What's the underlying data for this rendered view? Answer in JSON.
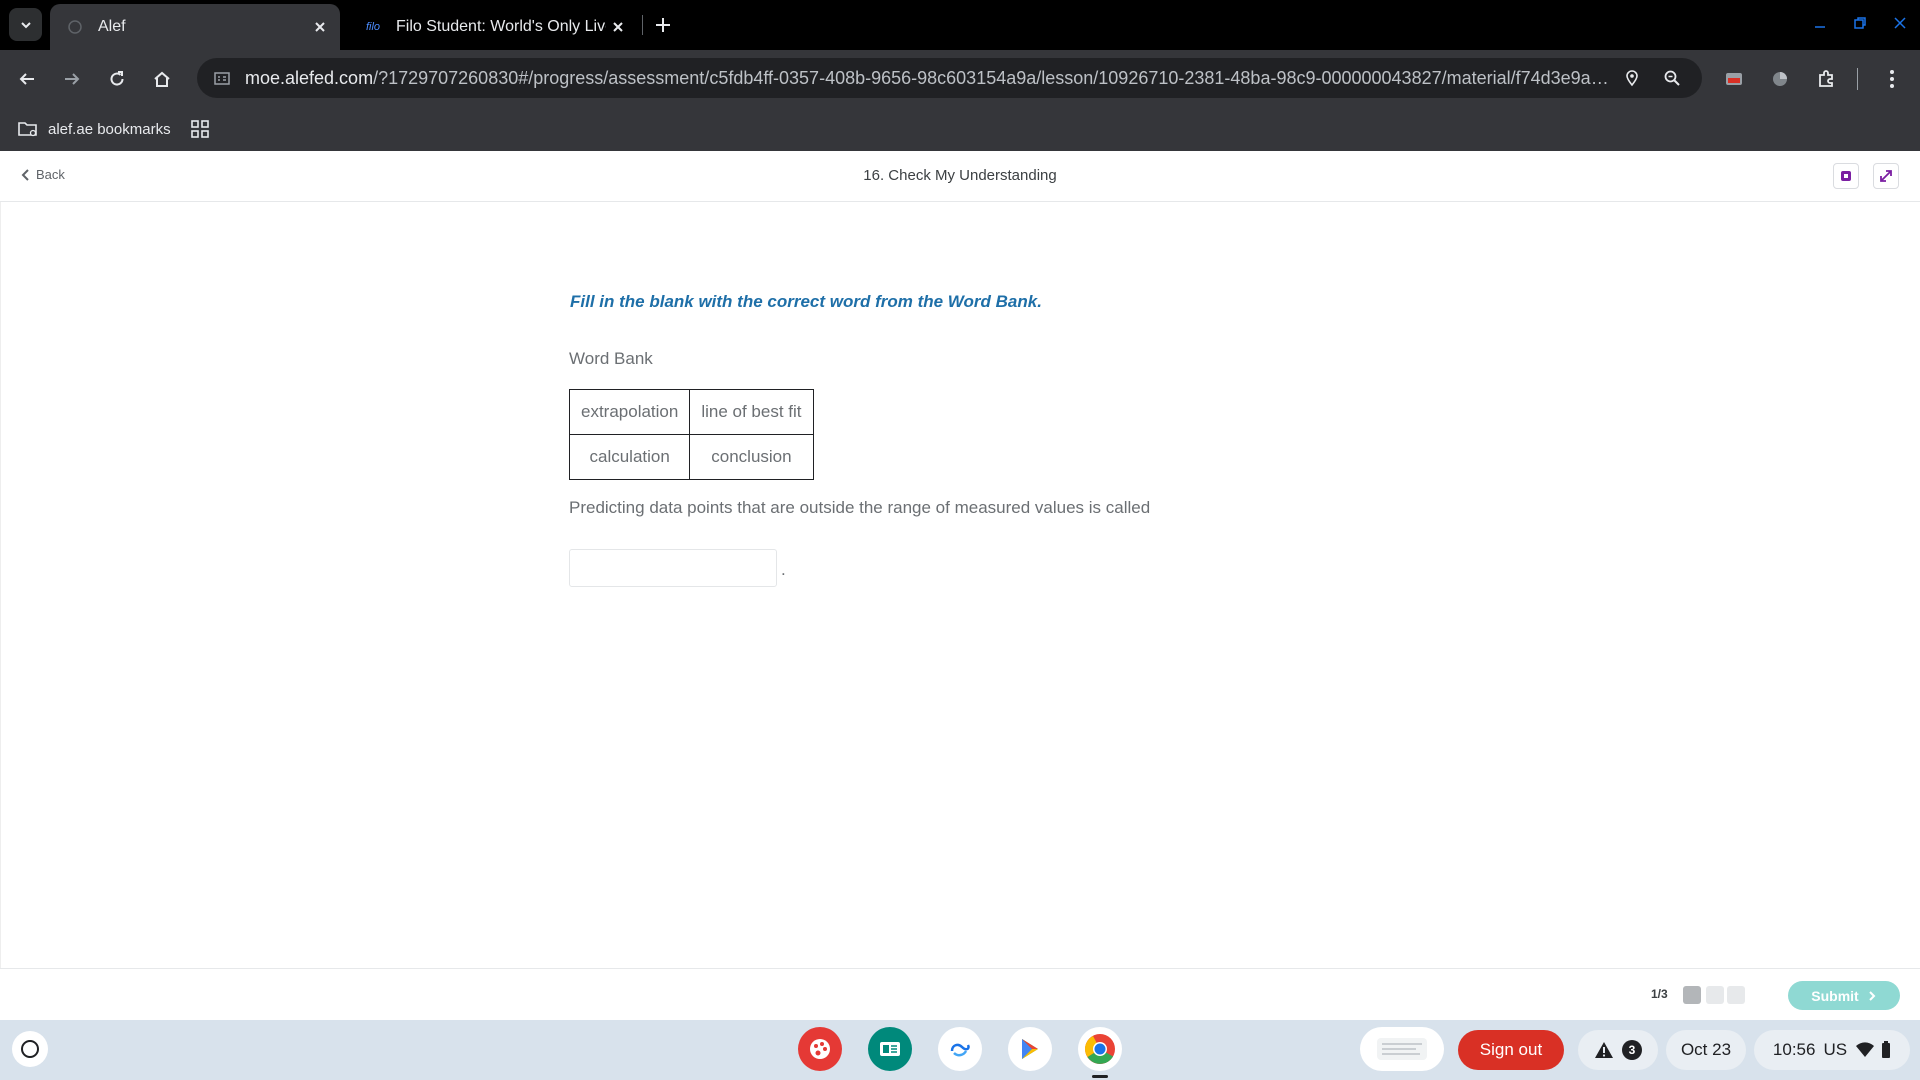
{
  "browser": {
    "tabs": [
      {
        "label": "Alef",
        "favicon": "alef-icon"
      },
      {
        "label": "Filo Student: World's Only Live I",
        "favicon": "filo-icon",
        "favicon_text": "filo"
      }
    ],
    "url_host": "moe.alefed.com",
    "url_path": "/?1729707260830#/progress/assessment/c5fdb4ff-0357-408b-9656-98c603154a9a/lesson/10926710-2381-48ba-98c9-000000043827/material/f74d3e9a-a...",
    "bookmark_folder": "alef.ae bookmarks"
  },
  "header": {
    "back_label": "Back",
    "title": "16. Check My Understanding"
  },
  "question": {
    "instruction": "Fill in the blank with the correct word from the Word Bank.",
    "word_bank_label": "Word Bank",
    "word_bank": [
      [
        "extrapolation",
        "line of best fit"
      ],
      [
        "calculation",
        "conclusion"
      ]
    ],
    "prompt": "Predicting data points that are outside the range of measured values is called",
    "answer_value": "",
    "answer_suffix": "."
  },
  "footer": {
    "pager": "1/3",
    "submit_label": "Submit"
  },
  "shelf": {
    "sign_out": "Sign out",
    "notification_count": "3",
    "date": "Oct 23",
    "time": "10:56",
    "locale": "US"
  },
  "colors": {
    "instruction": "#1e6fa8",
    "submit": "#8fd9d3",
    "sign_out": "#d93025"
  }
}
